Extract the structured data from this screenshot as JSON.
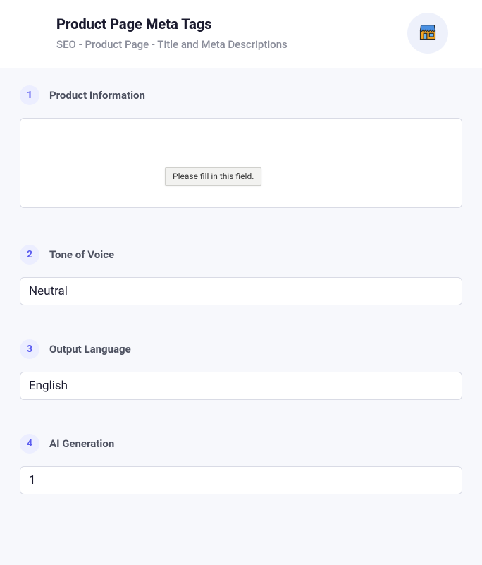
{
  "header": {
    "title": "Product Page Meta Tags",
    "subtitle": "SEO - Product Page - Title and Meta Descriptions",
    "avatar_icon": "storefront-icon"
  },
  "sections": {
    "s1": {
      "num": "1",
      "label": "Product Information",
      "tooltip": "Please fill in this field."
    },
    "s2": {
      "num": "2",
      "label": "Tone of Voice",
      "value": "Neutral"
    },
    "s3": {
      "num": "3",
      "label": "Output Language",
      "value": "English"
    },
    "s4": {
      "num": "4",
      "label": "AI Generation",
      "value": "1"
    }
  }
}
